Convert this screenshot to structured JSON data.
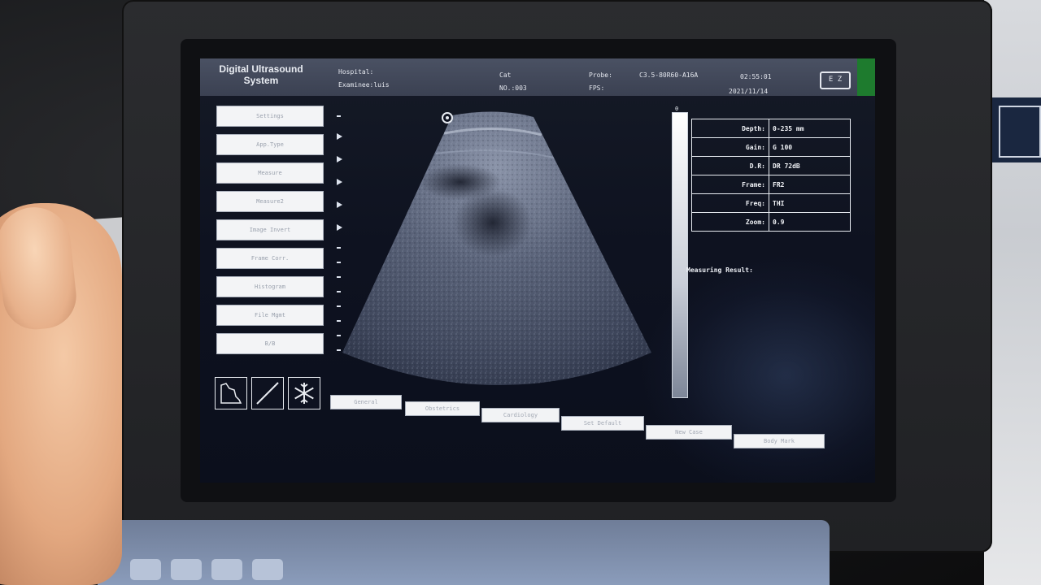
{
  "header": {
    "brand": "Digital Ultrasound System",
    "hospital_label": "Hospital:",
    "examinee_label": "Examinee:luis",
    "patient_name": "Cat",
    "patient_no": "NO.:003",
    "probe_label": "Probe:",
    "probe_value": "C3.5-80R60-A16A",
    "fps_label": "FPS:",
    "time": "02:55:01",
    "date": "2021/11/14",
    "battery_icon": "battery-icon",
    "battery_text": "E Z"
  },
  "sidebar": {
    "items": [
      {
        "label": "Settings"
      },
      {
        "label": "App.Type"
      },
      {
        "label": "Measure"
      },
      {
        "label": "Measure2"
      },
      {
        "label": "Image Invert"
      },
      {
        "label": "Frame Corr."
      },
      {
        "label": "Histogram"
      },
      {
        "label": "File Mgmt"
      },
      {
        "label": "B/B"
      }
    ]
  },
  "tools": [
    {
      "icon": "cine-icon"
    },
    {
      "icon": "line-measure-icon"
    },
    {
      "icon": "freeze-snowflake-icon"
    }
  ],
  "scale": {
    "label": "0"
  },
  "params": {
    "rows": [
      {
        "key": "Depth:",
        "value": "0-235 mm"
      },
      {
        "key": "Gain:",
        "value": "G 100"
      },
      {
        "key": "D.R:",
        "value": "DR 72dB"
      },
      {
        "key": "Frame:",
        "value": "FR2"
      },
      {
        "key": "Freq:",
        "value": "THI"
      },
      {
        "key": "Zoom:",
        "value": "0.9"
      }
    ]
  },
  "measuring": {
    "label": "Measuring Result:"
  },
  "bottom_buttons": [
    {
      "label": "General"
    },
    {
      "label": "Obstetrics"
    },
    {
      "label": "Cardiology"
    },
    {
      "label": "Set Default"
    },
    {
      "label": "New Case"
    },
    {
      "label": "Body Mark"
    }
  ],
  "colors": {
    "header_bg": "#3b4152",
    "screen_bg": "#0e1220",
    "button_bg": "#f3f4f6",
    "text_light": "#e8ecf2"
  }
}
